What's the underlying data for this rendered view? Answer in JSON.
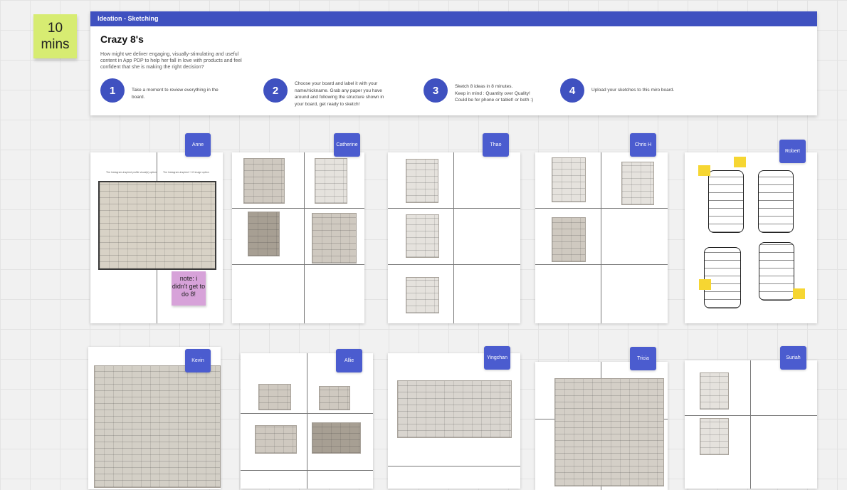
{
  "timer": {
    "line1": "10",
    "line2": "mins"
  },
  "banner": {
    "header": "Ideation - Sketching",
    "title": "Crazy 8's",
    "question": "How might we deliver engaging, visually-stimulating and useful content in App PDP to help her fall in love with products and feel confident that she is making the right decision?",
    "steps": [
      {
        "number": "1",
        "text": "Take a moment to review everything in the\nboard."
      },
      {
        "number": "2",
        "text": "Choose your board and label it with your\nname/nickname. Grab any paper you have\naround and following the structure shown in\nyour board, get ready to sketch!"
      },
      {
        "number": "3",
        "text": "Sketch 8 ideas in 8 minutes.\nKeep in mind : Quantity over Quality!\nCould be for phone or tablet! or both :)"
      },
      {
        "number": "4",
        "text": "Upload your sketches to this miro board."
      }
    ]
  },
  "boards": {
    "anne": {
      "name": "Anne",
      "caption_left": "The Instagram-inspired profile visual(s) option",
      "caption_right": "The Instagram-inspired + IG image option",
      "note": "note: i didn't get to do 8!"
    },
    "catherine": {
      "name": "Catherine"
    },
    "thao": {
      "name": "Thao"
    },
    "chris": {
      "name": "Chris H"
    },
    "robert": {
      "name": "Robert"
    },
    "kevin": {
      "name": "Kevin"
    },
    "allie": {
      "name": "Allie"
    },
    "yingchan": {
      "name": "Yingchan"
    },
    "tricia": {
      "name": "Tricia"
    },
    "suriah": {
      "name": "Suriah"
    }
  }
}
